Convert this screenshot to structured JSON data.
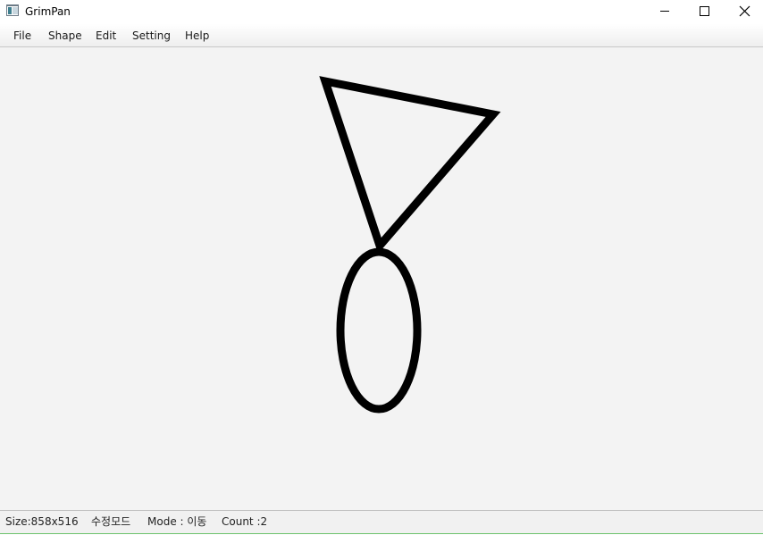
{
  "window": {
    "title": "GrimPan",
    "controls": {
      "minimize": "minimize-icon",
      "maximize": "maximize-icon",
      "close": "close-icon"
    }
  },
  "menubar": {
    "items": [
      {
        "label": "File"
      },
      {
        "label": "Shape"
      },
      {
        "label": "Edit"
      },
      {
        "label": "Setting"
      },
      {
        "label": "Help"
      }
    ]
  },
  "canvas": {
    "background": "#f3f3f3",
    "stroke_color": "#000000",
    "shapes": [
      {
        "type": "triangle",
        "name": "triangle-shape"
      },
      {
        "type": "ellipse",
        "name": "ellipse-shape"
      }
    ]
  },
  "statusbar": {
    "size_text": "Size:858x516",
    "edit_text": "수정모드",
    "mode_text": "Mode : 이동",
    "count_text": "Count :2"
  }
}
